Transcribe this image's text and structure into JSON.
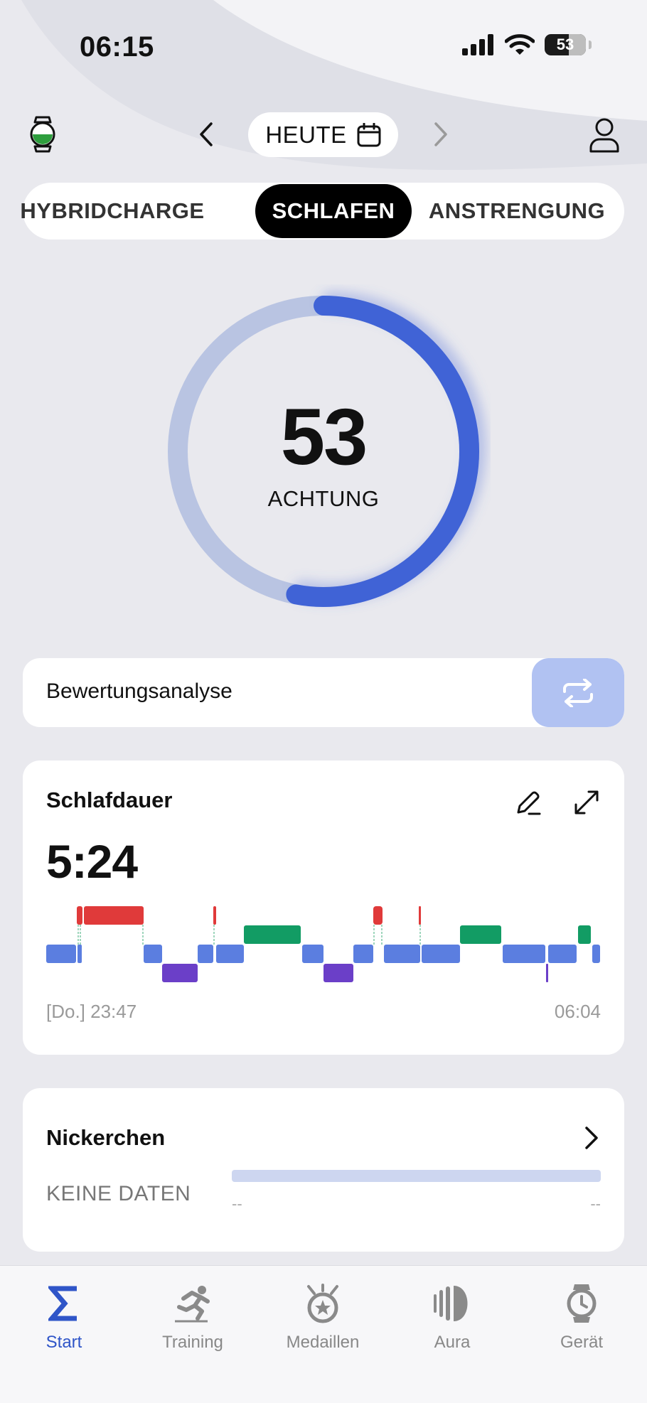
{
  "status_bar": {
    "time": "06:15",
    "battery": "53"
  },
  "nav": {
    "date_label": "HEUTE"
  },
  "segments": [
    {
      "label": "HYBRIDCHARGE",
      "active": false
    },
    {
      "label": "SCHLAFEN",
      "active": true
    },
    {
      "label": "ANSTRENGUNG",
      "active": false
    }
  ],
  "score": {
    "value": "53",
    "label": "ACHTUNG",
    "fraction": 0.53
  },
  "analysis": {
    "label": "Bewertungsanalyse"
  },
  "sleep": {
    "title": "Schlafdauer",
    "duration": "5:24",
    "start_label": "[Do.] 23:47",
    "end_label": "06:04"
  },
  "nap": {
    "title": "Nickerchen",
    "status": "KEINE DATEN",
    "start_placeholder": "--",
    "end_placeholder": "--"
  },
  "tabs": [
    {
      "label": "Start",
      "icon": "sigma-icon",
      "active": true
    },
    {
      "label": "Training",
      "icon": "running-icon",
      "active": false
    },
    {
      "label": "Medaillen",
      "icon": "medal-icon",
      "active": false
    },
    {
      "label": "Aura",
      "icon": "aura-icon",
      "active": false
    },
    {
      "label": "Gerät",
      "icon": "watch-icon",
      "active": false
    }
  ],
  "colors": {
    "accent": "#3f63d6",
    "awake": "#e03a3a",
    "rem": "#129c64",
    "light": "#5b7ee0",
    "deep": "#6b3fc8"
  }
}
